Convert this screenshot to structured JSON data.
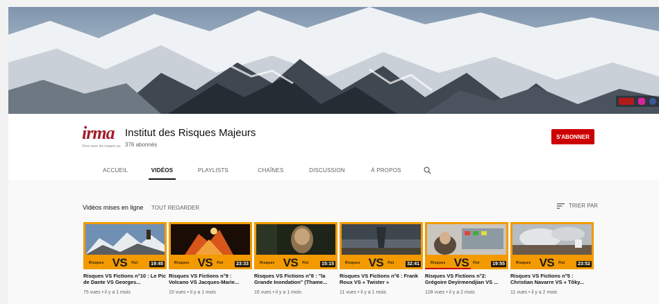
{
  "channel": {
    "name": "Institut des Risques Majeurs",
    "subscribers": "376 abonnés",
    "logo_text": "irma",
    "logo_tagline": "Vivre avec les risques au"
  },
  "actions": {
    "subscribe_label": "S'abonner"
  },
  "tabs": [
    {
      "label": "Accueil"
    },
    {
      "label": "Vidéos"
    },
    {
      "label": "Playlists"
    },
    {
      "label": "Chaînes"
    },
    {
      "label": "Discussion"
    },
    {
      "label": "À propos"
    }
  ],
  "section": {
    "title": "Vidéos mises en ligne",
    "play_all": "Tout regarder",
    "sort_label": "Trier par"
  },
  "thumbnail_branding": {
    "left": "Risques",
    "center": "VS",
    "right": "Fict"
  },
  "videos": [
    {
      "title": "Risques VS Fictions n°10 : Le Pic de Dante VS Georges...",
      "duration": "19:45",
      "meta": "75 vues • il y a 1 mois"
    },
    {
      "title": "Risques VS Fictions n°9 : Volcano VS Jacques-Marie...",
      "duration": "23:33",
      "meta": "15 vues • il y a 1 mois"
    },
    {
      "title": "Risques VS Fictions n°8 : \"la Grande Inondation\" (Thame...",
      "duration": "15:15",
      "meta": "16 vues • il y a 1 mois"
    },
    {
      "title": "Risques VS Fictions n°6 : Frank Roux VS « Twister »",
      "duration": "32:41",
      "meta": "11 vues • il y a 1 mois"
    },
    {
      "title": "Risques VS Fictions n°2: Grégoire Deyirmendjian VS ...",
      "duration": "19:55",
      "meta": "128 vues • il y a 2 mois",
      "progress": 0.55
    },
    {
      "title": "Risques VS Fictions n°5 : Christian Navarre VS « Tôky...",
      "duration": "23:52",
      "meta": "11 vues • il y a 2 mois"
    }
  ],
  "colors": {
    "accent": "#cc0000",
    "thumb_orange": "#f29a00",
    "brand": "#a51d2d"
  }
}
